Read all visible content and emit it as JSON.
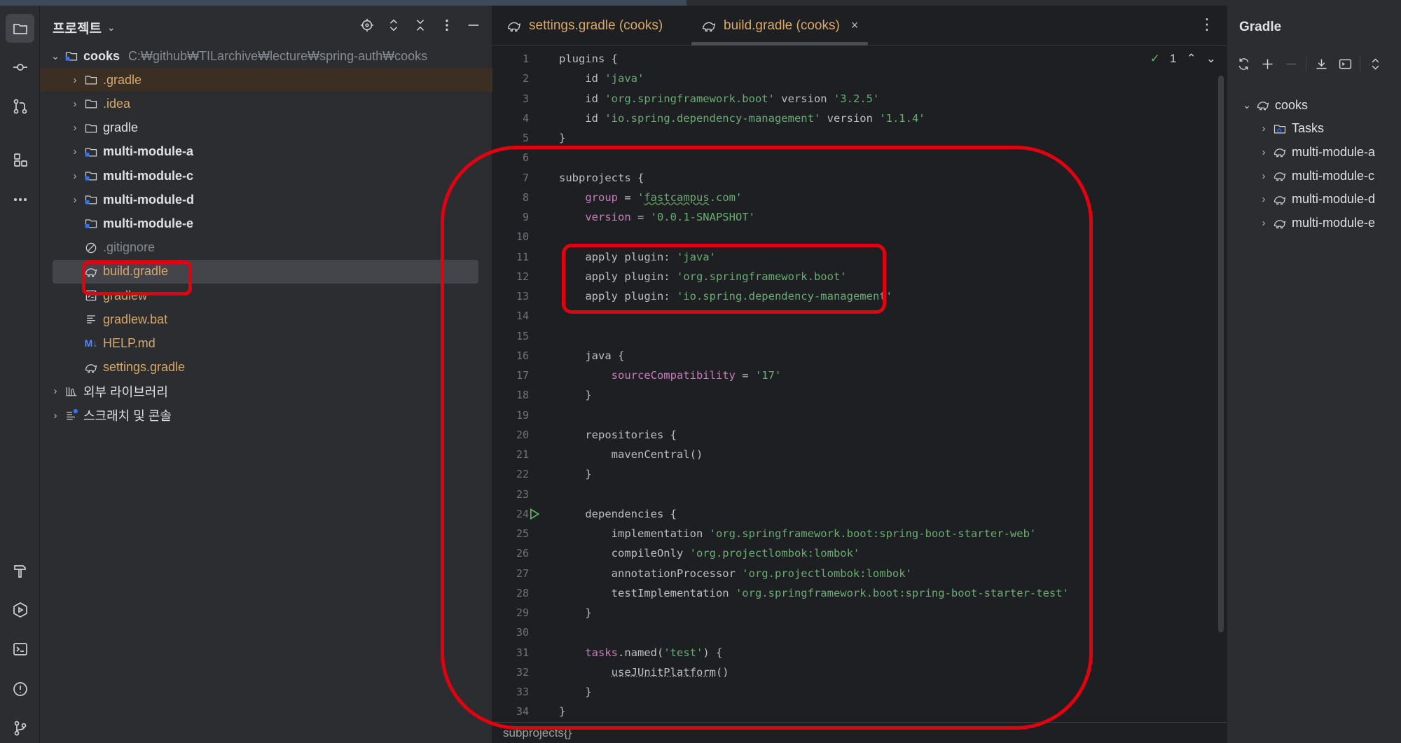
{
  "project_panel": {
    "title": "프로젝트",
    "tree": [
      {
        "label": "cooks",
        "path": "C:₩github₩TILarchive₩lecture₩spring-auth₩cooks",
        "icon": "module-folder-icon",
        "expanded": true
      },
      {
        "label": ".gradle",
        "icon": "folder-icon"
      },
      {
        "label": ".idea",
        "icon": "folder-icon"
      },
      {
        "label": "gradle",
        "icon": "folder-icon"
      },
      {
        "label": "multi-module-a",
        "icon": "module-folder-icon"
      },
      {
        "label": "multi-module-c",
        "icon": "module-folder-icon"
      },
      {
        "label": "multi-module-d",
        "icon": "module-folder-icon"
      },
      {
        "label": "multi-module-e",
        "icon": "module-folder-icon"
      },
      {
        "label": ".gitignore",
        "icon": "ignore-file-icon"
      },
      {
        "label": "build.gradle",
        "icon": "gradle-elephant-icon",
        "selected": true
      },
      {
        "label": "gradlew",
        "icon": "terminal-file-icon"
      },
      {
        "label": "gradlew.bat",
        "icon": "text-file-icon"
      },
      {
        "label": "HELP.md",
        "icon": "markdown-icon",
        "icon_text": "M↓"
      },
      {
        "label": "settings.gradle",
        "icon": "gradle-elephant-icon"
      },
      {
        "label": "외부 라이브러리",
        "icon": "library-icon"
      },
      {
        "label": "스크래치 및 콘솔",
        "icon": "scratch-icon"
      }
    ]
  },
  "editor": {
    "tabs": [
      {
        "label": "settings.gradle (cooks)",
        "active": false
      },
      {
        "label": "build.gradle (cooks)",
        "active": true,
        "close": "×"
      }
    ],
    "inspection_count": "1",
    "breadcrumb": "subprojects{}",
    "lines": [
      {
        "n": "1",
        "tokens": [
          [
            "plugins {",
            "plain"
          ]
        ]
      },
      {
        "n": "2",
        "tokens": [
          [
            "    id ",
            "plain"
          ],
          [
            "'java'",
            "str"
          ]
        ]
      },
      {
        "n": "3",
        "tokens": [
          [
            "    id ",
            "plain"
          ],
          [
            "'org.springframework.boot'",
            "str"
          ],
          [
            " version ",
            "plain"
          ],
          [
            "'3.2.5'",
            "str"
          ]
        ]
      },
      {
        "n": "4",
        "tokens": [
          [
            "    id ",
            "plain"
          ],
          [
            "'io.spring.dependency-management'",
            "str"
          ],
          [
            " version ",
            "plain"
          ],
          [
            "'1.1.4'",
            "str"
          ]
        ]
      },
      {
        "n": "5",
        "tokens": [
          [
            "}",
            "plain"
          ]
        ]
      },
      {
        "n": "6",
        "tokens": []
      },
      {
        "n": "7",
        "tokens": [
          [
            "subprojects {",
            "plain"
          ]
        ]
      },
      {
        "n": "8",
        "tokens": [
          [
            "    ",
            "plain"
          ],
          [
            "group",
            "prop"
          ],
          [
            " = ",
            "plain"
          ],
          [
            "'",
            "str"
          ],
          [
            "fastcampus",
            "str-warn"
          ],
          [
            ".com'",
            "str"
          ]
        ]
      },
      {
        "n": "9",
        "tokens": [
          [
            "    ",
            "plain"
          ],
          [
            "version",
            "prop"
          ],
          [
            " = ",
            "plain"
          ],
          [
            "'0.0.1-SNAPSHOT'",
            "str"
          ]
        ]
      },
      {
        "n": "10",
        "tokens": []
      },
      {
        "n": "11",
        "tokens": [
          [
            "    apply plugin: ",
            "plain"
          ],
          [
            "'java'",
            "str"
          ]
        ]
      },
      {
        "n": "12",
        "tokens": [
          [
            "    apply plugin: ",
            "plain"
          ],
          [
            "'org.springframework.boot'",
            "str"
          ]
        ]
      },
      {
        "n": "13",
        "tokens": [
          [
            "    apply plugin: ",
            "plain"
          ],
          [
            "'io.spring.dependency-management'",
            "str"
          ]
        ]
      },
      {
        "n": "14",
        "tokens": []
      },
      {
        "n": "15",
        "tokens": []
      },
      {
        "n": "16",
        "tokens": [
          [
            "    java {",
            "plain"
          ]
        ]
      },
      {
        "n": "17",
        "tokens": [
          [
            "        ",
            "plain"
          ],
          [
            "sourceCompatibility",
            "prop"
          ],
          [
            " = ",
            "plain"
          ],
          [
            "'17'",
            "str"
          ]
        ]
      },
      {
        "n": "18",
        "tokens": [
          [
            "    }",
            "plain"
          ]
        ]
      },
      {
        "n": "19",
        "tokens": []
      },
      {
        "n": "20",
        "tokens": [
          [
            "    repositories {",
            "plain"
          ]
        ]
      },
      {
        "n": "21",
        "tokens": [
          [
            "        mavenCentral()",
            "plain"
          ]
        ]
      },
      {
        "n": "22",
        "tokens": [
          [
            "    }",
            "plain"
          ]
        ]
      },
      {
        "n": "23",
        "tokens": []
      },
      {
        "n": "24",
        "tokens": [
          [
            "    dependencies {",
            "plain"
          ]
        ],
        "run": true
      },
      {
        "n": "25",
        "tokens": [
          [
            "        implementation ",
            "plain"
          ],
          [
            "'org.springframework.boot:spring-boot-starter-web'",
            "str"
          ]
        ]
      },
      {
        "n": "26",
        "tokens": [
          [
            "        compileOnly ",
            "plain"
          ],
          [
            "'org.projectlombok:lombok'",
            "str"
          ]
        ]
      },
      {
        "n": "27",
        "tokens": [
          [
            "        annotationProcessor ",
            "plain"
          ],
          [
            "'org.projectlombok:lombok'",
            "str"
          ]
        ]
      },
      {
        "n": "28",
        "tokens": [
          [
            "        testImplementation ",
            "plain"
          ],
          [
            "'org.springframework.boot:spring-boot-starter-test'",
            "str"
          ]
        ]
      },
      {
        "n": "29",
        "tokens": [
          [
            "    }",
            "plain"
          ]
        ]
      },
      {
        "n": "30",
        "tokens": []
      },
      {
        "n": "31",
        "tokens": [
          [
            "    ",
            "plain"
          ],
          [
            "tasks",
            "prop"
          ],
          [
            ".named(",
            "plain"
          ],
          [
            "'test'",
            "str"
          ],
          [
            ") {",
            "plain"
          ]
        ]
      },
      {
        "n": "32",
        "tokens": [
          [
            "        ",
            "plain"
          ],
          [
            "useJUnitPlatform",
            "under"
          ],
          [
            "()",
            "plain"
          ]
        ]
      },
      {
        "n": "33",
        "tokens": [
          [
            "    }",
            "plain"
          ]
        ]
      },
      {
        "n": "34",
        "tokens": [
          [
            "}",
            "plain"
          ]
        ]
      }
    ]
  },
  "gradle_panel": {
    "title": "Gradle",
    "tree": [
      {
        "label": "cooks",
        "expanded": true
      },
      {
        "label": "Tasks"
      },
      {
        "label": "multi-module-a"
      },
      {
        "label": "multi-module-c"
      },
      {
        "label": "multi-module-d"
      },
      {
        "label": "multi-module-e"
      }
    ]
  },
  "colors": {
    "annotation": "#e3000f",
    "string": "#6aab73",
    "property": "#c77dbb",
    "folder_ignored": "#d5a86b"
  }
}
